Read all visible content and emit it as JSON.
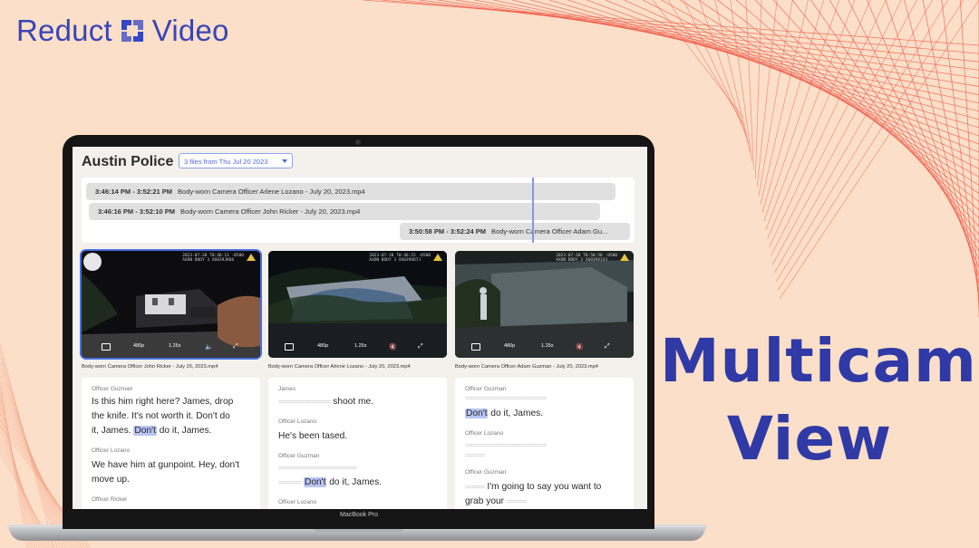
{
  "brand": {
    "word_left": "Reduct",
    "word_right": "Video",
    "accent": "#3845b8"
  },
  "headline": {
    "line1": "Multicam",
    "line2": "View",
    "color": "#2f3aa6"
  },
  "laptop": {
    "model": "MacBook Pro"
  },
  "app": {
    "title": "Austin Police",
    "file_select": {
      "value": "3 files from Thu Jul 20 2023",
      "icon": "chevron-down-icon"
    },
    "timeline": [
      {
        "time": "3:46:14 PM - 3:52:21 PM",
        "name": "Body-worn Camera Officer Arlene Lozano - July 20, 2023.mp4"
      },
      {
        "time": "3:46:16 PM - 3:52:10 PM",
        "name": "Body-worn Camera Officer John Ricker - July 20, 2023.mp4"
      },
      {
        "time": "3:50:58 PM - 3:52:24 PM",
        "name": "Body-worn Camera Officer Adam Gu..."
      }
    ],
    "videos": [
      {
        "caption": "Body-worn Camera Officer John Ricker - July 20, 2023.mp4",
        "quality": "480p",
        "speed": "1.25x",
        "stamp1": "2023-07-20 T0:46:11 -0500",
        "stamp2": "AXON BODY 3 X6039JK86",
        "audio_icon": "volume-icon",
        "active": true
      },
      {
        "caption": "Body-worn Camera Officer Arlene Lozano - July 20, 2023.mp4",
        "quality": "480p",
        "speed": "1.25x",
        "stamp1": "2023-07-20 T0:46:15 -0500",
        "stamp2": "AXON BODY 3 X6039UU7J",
        "audio_icon": "mute-icon",
        "active": false
      },
      {
        "caption": "Body-worn Camera Officer Adam Guzman - July 20, 2023.mp4",
        "quality": "480p",
        "speed": "1.25x",
        "stamp1": "2023-07-20 T0:50:58 -0500",
        "stamp2": "AXON BODY 3 X6039V1V3",
        "audio_icon": "mute-icon",
        "active": false
      }
    ],
    "transcripts": [
      {
        "b1_speaker": "Officer Guzman",
        "b1_a": "Is this him right here? James, drop",
        "b1_b": "the knife. It's not worth it. Don't do",
        "b1_c_pre": "it, James. ",
        "b1_c_hl": "Don't",
        "b1_c_post": " do it, James.",
        "b2_speaker": "Officer Lozano",
        "b2_a": "We have him at gunpoint. Hey, don't",
        "b2_b": "move up.",
        "b3_speaker": "Officer Ricker"
      },
      {
        "b1_speaker": "James",
        "b1_dash": "================",
        "b1_text": " shoot me.",
        "b2_speaker": "Officer Lozano",
        "b2_text": "He's been tased.",
        "b3_speaker": "Officer Guzman",
        "b3_dash1": "========================",
        "b3_dash2": "=======",
        "b3_hl": "Don't",
        "b3_post": " do it, James.",
        "b4_speaker": "Officer Lozano"
      },
      {
        "b1_speaker": "Officer Guzman",
        "b1_dash": "=========================",
        "b1_hl": "Don't",
        "b1_post": " do it, James.",
        "b2_speaker": "Officer Lozano",
        "b2_dash1": "=========================",
        "b2_dash2": "======",
        "b3_speaker": "Officer Guzman",
        "b3_dash": "======",
        "b3_a": " I'm going to say you want to",
        "b3_b": "grab your ",
        "b3_dash_end": "======"
      }
    ]
  }
}
